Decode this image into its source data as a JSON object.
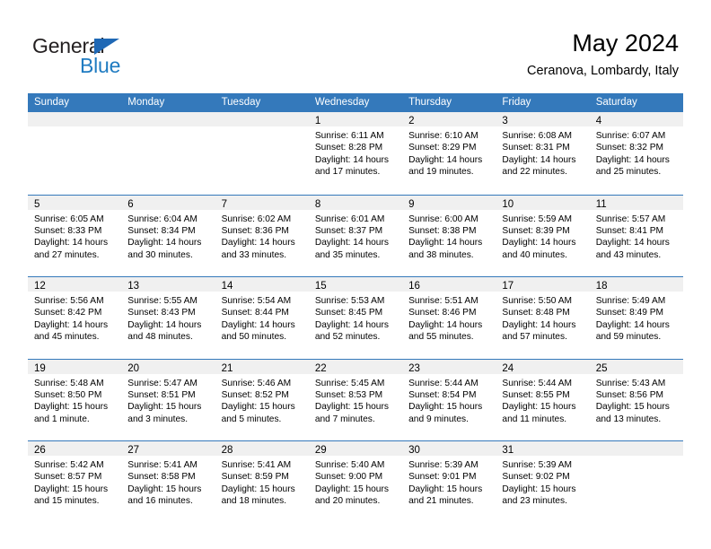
{
  "brand": {
    "name_part1": "General",
    "name_part2": "Blue",
    "triangle_color": "#1f68b5",
    "blue_color": "#1f7bc1"
  },
  "header": {
    "title": "May 2024",
    "subtitle": "Ceranova, Lombardy, Italy"
  },
  "theme": {
    "header_blue": "#3479bb",
    "daynum_strip": "#f0f0f0"
  },
  "weekday_headers": [
    "Sunday",
    "Monday",
    "Tuesday",
    "Wednesday",
    "Thursday",
    "Friday",
    "Saturday"
  ],
  "weeks": [
    [
      {
        "day": "",
        "empty": true,
        "lines": []
      },
      {
        "day": "",
        "empty": true,
        "lines": []
      },
      {
        "day": "",
        "empty": true,
        "lines": []
      },
      {
        "day": "1",
        "empty": false,
        "lines": [
          "Sunrise: 6:11 AM",
          "Sunset: 8:28 PM",
          "Daylight: 14 hours",
          "and 17 minutes."
        ]
      },
      {
        "day": "2",
        "empty": false,
        "lines": [
          "Sunrise: 6:10 AM",
          "Sunset: 8:29 PM",
          "Daylight: 14 hours",
          "and 19 minutes."
        ]
      },
      {
        "day": "3",
        "empty": false,
        "lines": [
          "Sunrise: 6:08 AM",
          "Sunset: 8:31 PM",
          "Daylight: 14 hours",
          "and 22 minutes."
        ]
      },
      {
        "day": "4",
        "empty": false,
        "lines": [
          "Sunrise: 6:07 AM",
          "Sunset: 8:32 PM",
          "Daylight: 14 hours",
          "and 25 minutes."
        ]
      }
    ],
    [
      {
        "day": "5",
        "empty": false,
        "lines": [
          "Sunrise: 6:05 AM",
          "Sunset: 8:33 PM",
          "Daylight: 14 hours",
          "and 27 minutes."
        ]
      },
      {
        "day": "6",
        "empty": false,
        "lines": [
          "Sunrise: 6:04 AM",
          "Sunset: 8:34 PM",
          "Daylight: 14 hours",
          "and 30 minutes."
        ]
      },
      {
        "day": "7",
        "empty": false,
        "lines": [
          "Sunrise: 6:02 AM",
          "Sunset: 8:36 PM",
          "Daylight: 14 hours",
          "and 33 minutes."
        ]
      },
      {
        "day": "8",
        "empty": false,
        "lines": [
          "Sunrise: 6:01 AM",
          "Sunset: 8:37 PM",
          "Daylight: 14 hours",
          "and 35 minutes."
        ]
      },
      {
        "day": "9",
        "empty": false,
        "lines": [
          "Sunrise: 6:00 AM",
          "Sunset: 8:38 PM",
          "Daylight: 14 hours",
          "and 38 minutes."
        ]
      },
      {
        "day": "10",
        "empty": false,
        "lines": [
          "Sunrise: 5:59 AM",
          "Sunset: 8:39 PM",
          "Daylight: 14 hours",
          "and 40 minutes."
        ]
      },
      {
        "day": "11",
        "empty": false,
        "lines": [
          "Sunrise: 5:57 AM",
          "Sunset: 8:41 PM",
          "Daylight: 14 hours",
          "and 43 minutes."
        ]
      }
    ],
    [
      {
        "day": "12",
        "empty": false,
        "lines": [
          "Sunrise: 5:56 AM",
          "Sunset: 8:42 PM",
          "Daylight: 14 hours",
          "and 45 minutes."
        ]
      },
      {
        "day": "13",
        "empty": false,
        "lines": [
          "Sunrise: 5:55 AM",
          "Sunset: 8:43 PM",
          "Daylight: 14 hours",
          "and 48 minutes."
        ]
      },
      {
        "day": "14",
        "empty": false,
        "lines": [
          "Sunrise: 5:54 AM",
          "Sunset: 8:44 PM",
          "Daylight: 14 hours",
          "and 50 minutes."
        ]
      },
      {
        "day": "15",
        "empty": false,
        "lines": [
          "Sunrise: 5:53 AM",
          "Sunset: 8:45 PM",
          "Daylight: 14 hours",
          "and 52 minutes."
        ]
      },
      {
        "day": "16",
        "empty": false,
        "lines": [
          "Sunrise: 5:51 AM",
          "Sunset: 8:46 PM",
          "Daylight: 14 hours",
          "and 55 minutes."
        ]
      },
      {
        "day": "17",
        "empty": false,
        "lines": [
          "Sunrise: 5:50 AM",
          "Sunset: 8:48 PM",
          "Daylight: 14 hours",
          "and 57 minutes."
        ]
      },
      {
        "day": "18",
        "empty": false,
        "lines": [
          "Sunrise: 5:49 AM",
          "Sunset: 8:49 PM",
          "Daylight: 14 hours",
          "and 59 minutes."
        ]
      }
    ],
    [
      {
        "day": "19",
        "empty": false,
        "lines": [
          "Sunrise: 5:48 AM",
          "Sunset: 8:50 PM",
          "Daylight: 15 hours",
          "and 1 minute."
        ]
      },
      {
        "day": "20",
        "empty": false,
        "lines": [
          "Sunrise: 5:47 AM",
          "Sunset: 8:51 PM",
          "Daylight: 15 hours",
          "and 3 minutes."
        ]
      },
      {
        "day": "21",
        "empty": false,
        "lines": [
          "Sunrise: 5:46 AM",
          "Sunset: 8:52 PM",
          "Daylight: 15 hours",
          "and 5 minutes."
        ]
      },
      {
        "day": "22",
        "empty": false,
        "lines": [
          "Sunrise: 5:45 AM",
          "Sunset: 8:53 PM",
          "Daylight: 15 hours",
          "and 7 minutes."
        ]
      },
      {
        "day": "23",
        "empty": false,
        "lines": [
          "Sunrise: 5:44 AM",
          "Sunset: 8:54 PM",
          "Daylight: 15 hours",
          "and 9 minutes."
        ]
      },
      {
        "day": "24",
        "empty": false,
        "lines": [
          "Sunrise: 5:44 AM",
          "Sunset: 8:55 PM",
          "Daylight: 15 hours",
          "and 11 minutes."
        ]
      },
      {
        "day": "25",
        "empty": false,
        "lines": [
          "Sunrise: 5:43 AM",
          "Sunset: 8:56 PM",
          "Daylight: 15 hours",
          "and 13 minutes."
        ]
      }
    ],
    [
      {
        "day": "26",
        "empty": false,
        "lines": [
          "Sunrise: 5:42 AM",
          "Sunset: 8:57 PM",
          "Daylight: 15 hours",
          "and 15 minutes."
        ]
      },
      {
        "day": "27",
        "empty": false,
        "lines": [
          "Sunrise: 5:41 AM",
          "Sunset: 8:58 PM",
          "Daylight: 15 hours",
          "and 16 minutes."
        ]
      },
      {
        "day": "28",
        "empty": false,
        "lines": [
          "Sunrise: 5:41 AM",
          "Sunset: 8:59 PM",
          "Daylight: 15 hours",
          "and 18 minutes."
        ]
      },
      {
        "day": "29",
        "empty": false,
        "lines": [
          "Sunrise: 5:40 AM",
          "Sunset: 9:00 PM",
          "Daylight: 15 hours",
          "and 20 minutes."
        ]
      },
      {
        "day": "30",
        "empty": false,
        "lines": [
          "Sunrise: 5:39 AM",
          "Sunset: 9:01 PM",
          "Daylight: 15 hours",
          "and 21 minutes."
        ]
      },
      {
        "day": "31",
        "empty": false,
        "lines": [
          "Sunrise: 5:39 AM",
          "Sunset: 9:02 PM",
          "Daylight: 15 hours",
          "and 23 minutes."
        ]
      },
      {
        "day": "",
        "empty": true,
        "lines": []
      }
    ]
  ]
}
